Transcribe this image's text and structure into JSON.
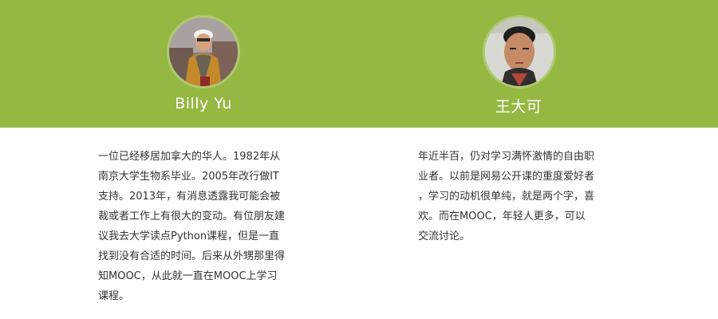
{
  "colors": {
    "header_band": "#95b843",
    "name_text": "#ffffff",
    "bio_text": "#333333"
  },
  "profiles": [
    {
      "name": "Billy Yu",
      "avatar_icon": "person-photo-avatar",
      "bio": "一位已经移居加拿大的华人。1982年从\n南京大学生物系毕业。2005年改行做IT\n支持。2013年，有消息透露我可能会被\n裁或者工作上有很大的变动。有位朋友建\n议我去大学读点Python课程，但是一直\n找到没有合适的时间。后来从外甥那里得\n知MOOC，从此就一直在MOOC上学习\n课程。"
    },
    {
      "name": "王大可",
      "avatar_icon": "person-photo-avatar",
      "bio": "年近半百，仍对学习满怀激情的自由职\n业者。以前是网易公开课的重度爱好者\n，学习的动机很单纯，就是两个字，喜\n欢。而在MOOC，年轻人更多，可以\n交流讨论。"
    }
  ]
}
